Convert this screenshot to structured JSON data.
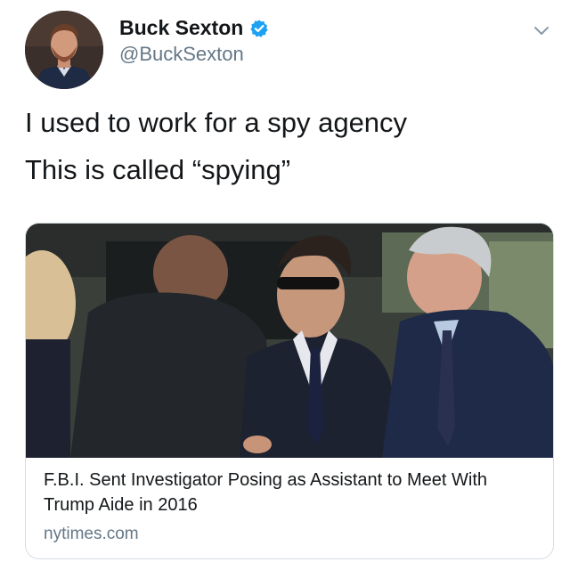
{
  "author": {
    "display_name": "Buck Sexton",
    "handle": "@BuckSexton",
    "verified": true
  },
  "tweet": {
    "lines": [
      "I used to work for a spy agency",
      "This is called “spying”"
    ]
  },
  "link_card": {
    "title": "F.B.I. Sent Investigator Posing as Assistant to Meet With Trump Aide in 2016",
    "domain": "nytimes.com"
  },
  "icons": {
    "verified": "verified-badge-icon",
    "menu": "chevron-down-icon"
  },
  "colors": {
    "verified_blue": "#1da1f2",
    "secondary_text": "#657786",
    "primary_text": "#14171a",
    "card_border": "#d6dde3"
  }
}
